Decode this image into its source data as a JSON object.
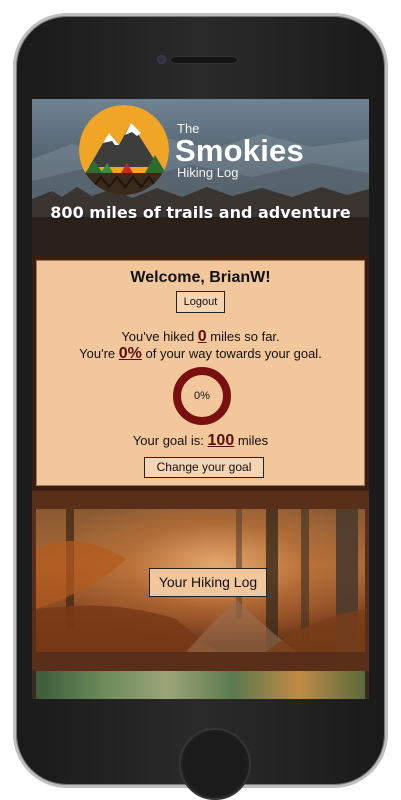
{
  "header": {
    "logo_the": "The",
    "logo_name": "Smokies",
    "logo_sub": "Hiking Log",
    "tagline": "800 miles of trails and adventure"
  },
  "welcome_panel": {
    "greeting": "Welcome, BrianW!",
    "logout_label": "Logout",
    "hiked_prefix": "You've hiked ",
    "miles_hiked": "0",
    "hiked_suffix": " miles so far.",
    "pct_prefix": "You're ",
    "percent_text": "0%",
    "pct_suffix": " of your way towards your goal.",
    "progress_ring_label": "0%",
    "progress_fraction": 0,
    "goal_prefix": "Your goal is: ",
    "goal_miles": "100",
    "goal_suffix": " miles",
    "change_goal_label": "Change your goal"
  },
  "cards": {
    "hiking_log_label": "Your Hiking Log"
  },
  "colors": {
    "panel_bg": "#f2c79c",
    "accent_dark_red": "#7a0f0f",
    "wood": "#5a2f1a"
  },
  "icons": {
    "logo": "mountain-tent-badge-icon"
  }
}
